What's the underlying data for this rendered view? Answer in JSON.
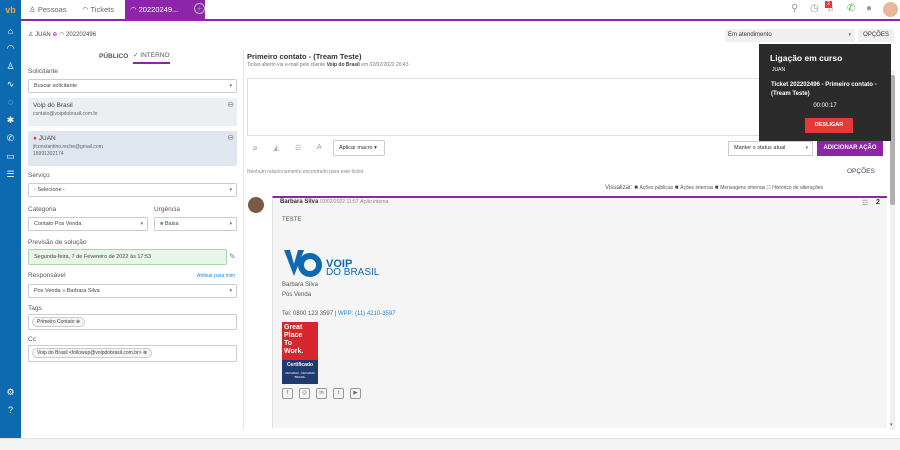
{
  "tabs": [
    {
      "label": "Pessoas"
    },
    {
      "label": "Tickets"
    },
    {
      "label": "20220249..."
    }
  ],
  "header": {
    "user": "JUAN",
    "ticket_id": "202202496",
    "status": "Em atendimento",
    "options": "OPÇÕES"
  },
  "visibility": {
    "public": "PÚBLICO",
    "internal": "INTERNO"
  },
  "form": {
    "solicitante_label": "Solicitante",
    "solicitante_placeholder": "Buscar solicitante",
    "org_name": "Voip do Brasil",
    "org_email": "contato@voipdobrasil.com.br",
    "contact_name": "JUAN",
    "contact_email": "jfconstantino.reche@gmail.com",
    "contact_phone": "18991302174",
    "servico_label": "Serviço",
    "servico_value": "- Selecione -",
    "categoria_label": "Categoria",
    "categoria_value": "Contato Pos Venda",
    "urgencia_label": "Urgência",
    "urgencia_value": "Baixa",
    "previsao_label": "Previsão de solução",
    "previsao_value": "Segunda-feira, 7 de Fevereiro de 2022 às 17:53",
    "responsavel_label": "Responsável",
    "atribuir": "Atribuir para mim",
    "responsavel_value": "Pos Venda » Barbara Silva",
    "tags_label": "Tags",
    "tag": "Primeiro Contato",
    "cc_label": "Cc",
    "cc": "Voip do Brasil <followup@voipdobrasil.com.br>"
  },
  "ticket": {
    "title": "Primeiro contato - (Tream Teste)",
    "subtitle_pre": "Ticket aberto via e-mail pelo cliente ",
    "subtitle_client": "Voip do Brasil",
    "subtitle_post": " em 02/02/2022 20:43"
  },
  "editor": {
    "macro": "Aplicar macro",
    "status_select": "Manter o status atual",
    "add_button": "ADICIONAR AÇÃO"
  },
  "no_rel": "Nenhum relacionamento encontrado para este ticket",
  "opcoes2": "OPÇÕES",
  "filters": {
    "label": "Visualizar:",
    "items": [
      "Ações públicas",
      "Ações internas",
      "Mensagens internas",
      "Histórico de alterações"
    ]
  },
  "action": {
    "author": "Barbara Silva",
    "date": "03/02/2022 11:57",
    "type": "Ação interna",
    "count": "2",
    "body": "TESTE"
  },
  "signature": {
    "logo_voip": "VOIP",
    "logo_brasil": "DO BRASIL",
    "name": "Barbara Silva",
    "role": "Pós Venda",
    "tel": "Tel: 0800 123 3597 |",
    "wpp": "WPP: (11) 4210-3597",
    "gptw": [
      "Great",
      "Place",
      "To",
      "Work."
    ],
    "gptw_cert": "Certificado",
    "gptw_period": "FEV/2022 - FEV/2023",
    "gptw_country": "BRASIL"
  },
  "social": [
    "f",
    "◎",
    "in",
    "t",
    "▶"
  ],
  "call": {
    "title": "Ligação em curso",
    "user": "JUAN",
    "ticket": "Ticket 202202496 - Primeiro contato - (Tream Teste)",
    "timer": "00:00:17",
    "hangup": "DESLIGAR"
  },
  "notif_count": "2",
  "colors": {
    "brand": "#0d6ab0",
    "accent": "#8e24aa",
    "danger": "#e53935"
  }
}
